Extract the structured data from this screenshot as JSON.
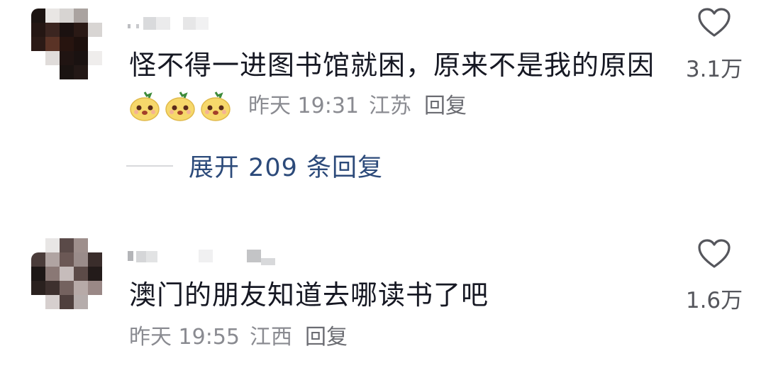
{
  "comments": [
    {
      "text": "怪不得一进图书馆就困，原来不是我的原因",
      "stickers": [
        "yellow-face-sticker",
        "yellow-face-sticker",
        "yellow-face-sticker"
      ],
      "time": "昨天 19:31",
      "location": "江苏",
      "reply_label": "回复",
      "likes": "3.1万",
      "expand_label": "展开 209 条回复"
    },
    {
      "text": "澳门的朋友知道去哪读书了吧",
      "time": "昨天 19:55",
      "location": "江西",
      "reply_label": "回复",
      "likes": "1.6万"
    }
  ],
  "colors": {
    "text": "#161823",
    "meta": "#8a8b91",
    "link": "#2c4a7a",
    "icon": "#55565c"
  }
}
